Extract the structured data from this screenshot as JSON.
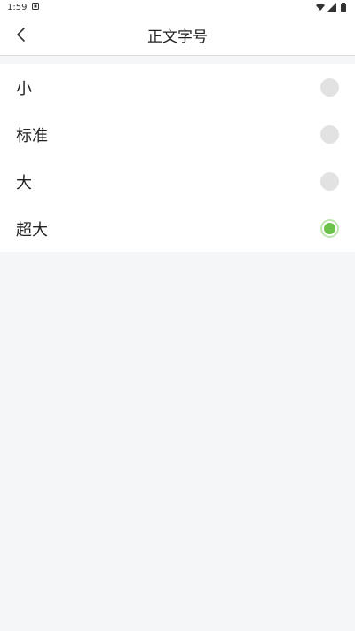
{
  "status_bar": {
    "time": "1:59"
  },
  "header": {
    "title": "正文字号"
  },
  "options": [
    {
      "label": "小",
      "selected": false
    },
    {
      "label": "标准",
      "selected": false
    },
    {
      "label": "大",
      "selected": false
    },
    {
      "label": "超大",
      "selected": true
    }
  ],
  "colors": {
    "accent": "#6cc24a",
    "radio_unselected": "#e2e2e2",
    "background": "#f5f6f8"
  }
}
